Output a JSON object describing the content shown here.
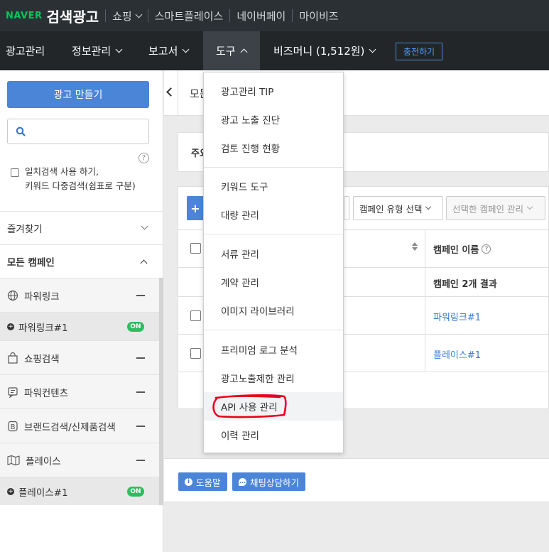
{
  "topbar": {
    "logo": "NAVER",
    "product": "검색광고",
    "links": [
      "쇼핑",
      "스마트플레이스",
      "네이버페이",
      "마이비즈"
    ]
  },
  "nav": {
    "items": [
      "광고관리",
      "정보관리",
      "보고서",
      "도구",
      "비즈머니 (1,512원)"
    ],
    "charge_label": "충전하기"
  },
  "sidebar": {
    "create_label": "광고 만들기",
    "help": "?",
    "exact_label_1": "일치검색 사용 하기,",
    "exact_label_2": "키워드 다중검색(쉼표로 구분)",
    "favorites": "즐겨찾기",
    "all_campaigns": "모든 캠페인",
    "groups": [
      {
        "label": "파워링크",
        "icon": "globe-icon"
      },
      {
        "label": "파워링크#1",
        "status": "ON"
      },
      {
        "label": "쇼핑검색",
        "icon": "shopping-bag-icon"
      },
      {
        "label": "파워컨텐츠",
        "icon": "content-icon"
      },
      {
        "label": "브랜드검색/신제품검색",
        "icon": "brand-b-icon"
      },
      {
        "label": "플레이스",
        "icon": "map-icon"
      },
      {
        "label": "플레이스#1",
        "status": "ON"
      }
    ]
  },
  "main": {
    "header_title_partial": "모든",
    "summary_partial": "주요",
    "campaign_type_select": "캠페인 유형 선택",
    "manage_select": "선택한 캠페인 관리",
    "col_campaign_name": "캠페인 이름",
    "result_count": "캠페인 2개 결과",
    "rows": [
      "파워링크#1",
      "플레이스#1"
    ],
    "help_button": "도움말",
    "chat_button": "채팅상담하기"
  },
  "dropdown": {
    "items": [
      "광고관리 TIP",
      "광고 노출 진단",
      "검토 진행 현황",
      "키워드 도구",
      "대량 관리",
      "서류 관리",
      "계약 관리",
      "이미지 라이브러리",
      "프리미엄 로그 분석",
      "광고노출제한 관리",
      "API 사용 관리",
      "이력 관리"
    ]
  },
  "colors": {
    "naver_green": "#03c75a",
    "topbar": "#2b3035",
    "navbar": "#222629",
    "primary_blue": "#4b85d8",
    "on_green": "#2dbd60",
    "annotation_red": "#e8001c"
  }
}
